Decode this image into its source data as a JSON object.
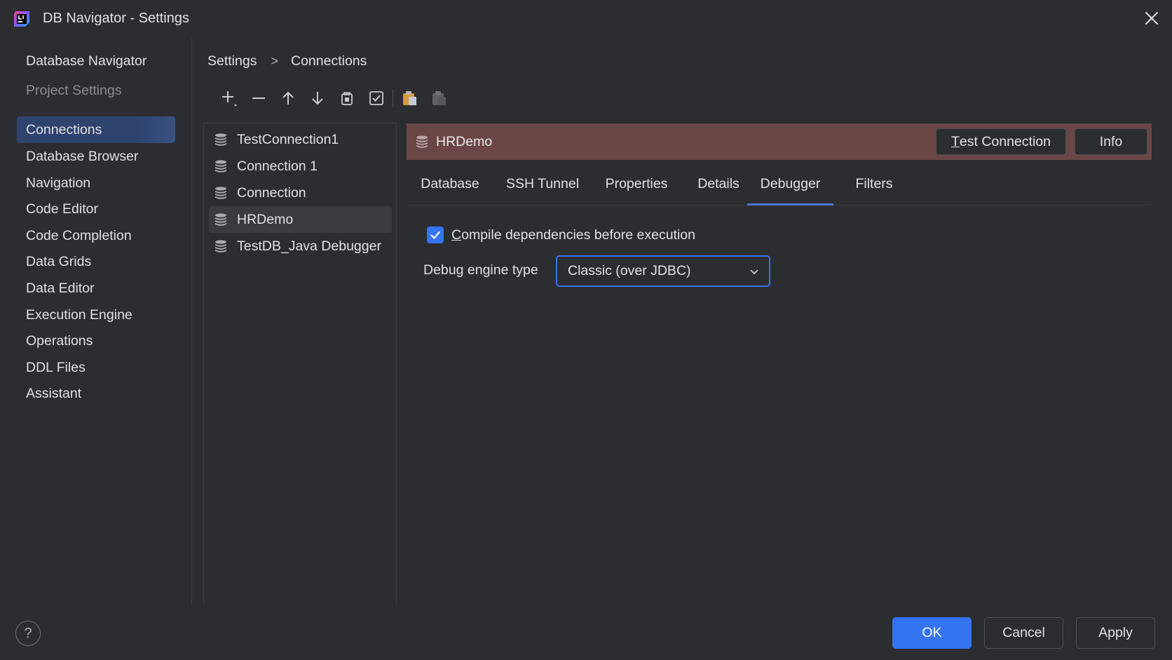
{
  "window": {
    "title": "DB Navigator - Settings",
    "logo_icon": "db-navigator-logo-icon",
    "close_icon": "close-icon"
  },
  "nav": {
    "header_items": [
      "Database Navigator",
      "Project Settings"
    ],
    "items": [
      {
        "label": "Connections",
        "selected": true
      },
      {
        "label": "Database Browser"
      },
      {
        "label": "Navigation"
      },
      {
        "label": "Code Editor"
      },
      {
        "label": "Code Completion"
      },
      {
        "label": "Data Grids"
      },
      {
        "label": "Data Editor"
      },
      {
        "label": "Execution Engine"
      },
      {
        "label": "Operations"
      },
      {
        "label": "DDL Files"
      },
      {
        "label": "Assistant"
      }
    ]
  },
  "breadcrumb": {
    "root": "Settings",
    "separator": ">",
    "current": "Connections"
  },
  "toolbar": {
    "icons": [
      "add-icon",
      "remove-icon",
      "move-up-icon",
      "move-down-icon",
      "copy-icon",
      "check-icon",
      "paste-icon",
      "paste-disabled-icon"
    ]
  },
  "connections": {
    "items": [
      {
        "label": "TestConnection1"
      },
      {
        "label": "Connection 1"
      },
      {
        "label": "Connection"
      },
      {
        "label": "HRDemo",
        "selected": true
      },
      {
        "label": "TestDB_Java Debugger"
      }
    ]
  },
  "detail": {
    "header_name": "HRDemo",
    "header_color": "#6a4646",
    "test_connection_first": "T",
    "test_connection_rest": "est Connection",
    "info_label": "Info",
    "tabs": [
      {
        "label": "Database"
      },
      {
        "label": "SSH Tunnel"
      },
      {
        "label": "Properties"
      },
      {
        "label": "Details"
      },
      {
        "label": "Debugger",
        "active": true
      },
      {
        "label": "Filters"
      }
    ],
    "compile_checkbox": {
      "checked": true,
      "label_first": "C",
      "label_rest": "ompile dependencies before execution"
    },
    "debug_engine_label": "Debug engine type",
    "debug_engine_value": "Classic (over JDBC)"
  },
  "footer": {
    "help_label": "?",
    "ok_label": "OK",
    "cancel_label": "Cancel",
    "apply_label": "Apply"
  },
  "colors": {
    "accent": "#3574f0",
    "background": "#2b2d30",
    "nav_selected": "#2e436e"
  }
}
